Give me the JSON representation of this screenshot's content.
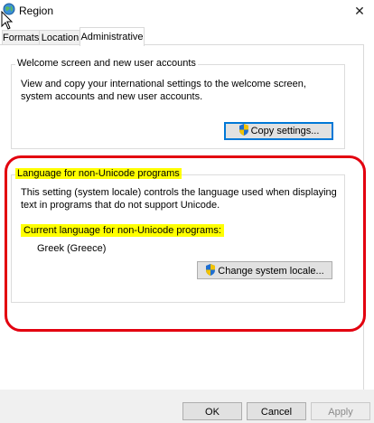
{
  "window": {
    "title": "Region",
    "close_glyph": "✕",
    "icon": "globe-icon"
  },
  "tabs": [
    {
      "label": "Formats",
      "active": false
    },
    {
      "label": "Location",
      "active": false
    },
    {
      "label": "Administrative",
      "active": true
    }
  ],
  "welcome": {
    "title": "Welcome screen and new user accounts",
    "description": "View and copy your international settings to the welcome screen, system accounts and new user accounts.",
    "button_label": "Copy settings...",
    "button_icon": "uac-shield-icon"
  },
  "unicode": {
    "title": "Language for non-Unicode programs",
    "description": "This setting (system locale) controls the language used when displaying text in programs that do not support Unicode.",
    "current_label": "Current language for non-Unicode programs:",
    "current_value": "Greek (Greece)",
    "button_label": "Change system locale...",
    "button_icon": "uac-shield-icon"
  },
  "footer": {
    "ok_label": "OK",
    "cancel_label": "Cancel",
    "apply_label": "Apply"
  },
  "colors": {
    "highlight": "#ffff00",
    "annotation_ring": "#e3000f",
    "focus": "#0078d7"
  }
}
